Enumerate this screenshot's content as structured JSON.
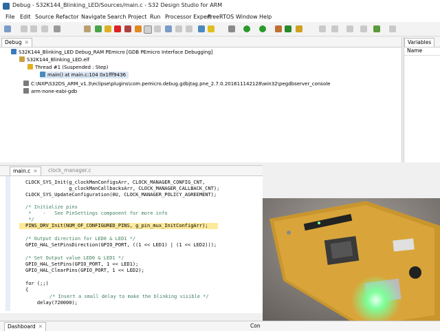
{
  "window": {
    "title": "Debug - S32K144_Blinking_LED/Sources/main.c - S32 Design Studio for ARM"
  },
  "menu": [
    "File",
    "Edit",
    "Source",
    "Refactor",
    "Navigate",
    "Search",
    "Project",
    "Run",
    "Processor Expert",
    "FreeRTOS",
    "Window",
    "Help"
  ],
  "debug_view": {
    "tab_label": "Debug",
    "tree": [
      "S32K144_Blinking_LED Debug_RAM PEmicro [GDB PEmicro Interface Debugging]",
      "S32K144_Blinking_LED.elf",
      "Thread #1 (Suspended : Step)",
      "main() at main.c:104 0x1fff9436",
      "C:\\NXP\\S32DS_ARM_v1.3\\eclipse\\plugins\\com.pemicro.debug.gdbjtag.pne_2.7.0.201611142128\\win32\\pegdbserver_console",
      "arm-none-eabi-gdb"
    ]
  },
  "variables_view": {
    "tab_label": "Variables",
    "column_name": "Name"
  },
  "editor": {
    "tabs": [
      "main.c",
      "clock_manager.c"
    ],
    "lines": [
      "CLOCK_SYS_Init(g_clockManConfigsArr, CLOCK_MANAGER_CONFIG_CNT,",
      "               g_clockManCallbacksArr, CLOCK_MANAGER_CALLBACK_CNT);",
      "CLOCK_SYS_UpdateConfiguration(0U, CLOCK_MANAGER_POLICY_AGREEMENT);",
      "",
      "/* Initialize pins",
      " *    -   See PinSettings component for more info",
      " */",
      "PINS_DRV_Init(NUM_OF_CONFIGURED_PINS, g_pin_mux_InitConfigArr);",
      "",
      "/* Output direction for LED0 & LED1 */",
      "GPIO_HAL_SetPinsDirection(GPIO_PORT, ((1 << LED1) | (1 << LED2)));",
      "",
      "/* Set Output value LED0 & LED1 */",
      "GPIO_HAL_SetPins(GPIO_PORT, 1 << LED1);",
      "GPIO_HAL_ClearPins(GPIO_PORT, 1 << LED2);",
      "",
      "for (;;)",
      "{",
      "    /* Insert a small delay to make the blinking visible */",
      "    delay(720000);"
    ]
  },
  "bottom_tabs": [
    "Dashboard",
    "Con"
  ],
  "colors": {
    "accent": "#2c6aa0",
    "highlight": "#fde99a",
    "comment": "#3f7f5f",
    "led": "#7dff9a"
  }
}
